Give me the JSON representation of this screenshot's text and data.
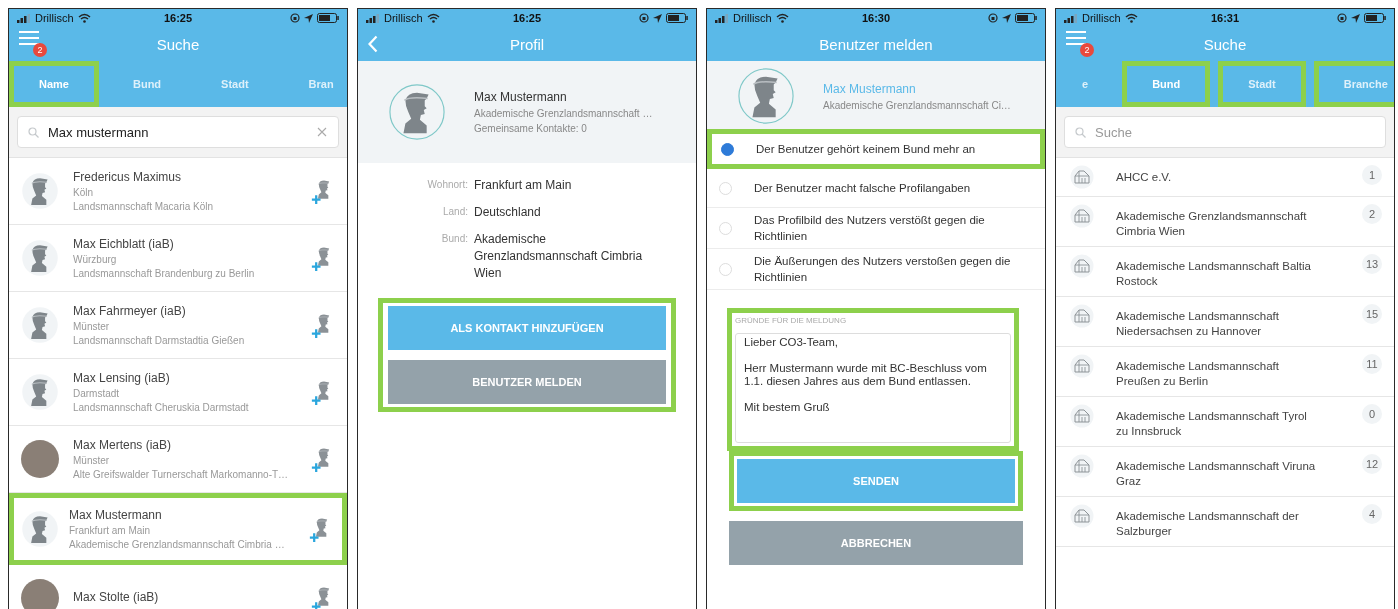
{
  "screens": [
    {
      "kind": "search_people",
      "status": {
        "carrier": "Drillisch",
        "time": "16:25"
      },
      "title": "Suche",
      "menu_badge": "2",
      "tabs": [
        {
          "label": "Name",
          "selected": true,
          "highlighted": true
        },
        {
          "label": "Bund",
          "selected": false,
          "highlighted": false
        },
        {
          "label": "Stadt",
          "selected": false,
          "highlighted": false
        },
        {
          "label": "Bran",
          "selected": false,
          "highlighted": false
        }
      ],
      "search": {
        "value": "Max mustermann"
      },
      "people": [
        {
          "name": "Fredericus Maximus",
          "city": "Köln",
          "bund": "Landsmannschaft Macaria Köln",
          "kind": "silhouette",
          "highlighted": false
        },
        {
          "name": "Max Eichblatt (iaB)",
          "city": "Würzburg",
          "bund": "Landsmannschaft Brandenburg zu Berlin",
          "kind": "silhouette",
          "highlighted": false
        },
        {
          "name": "Max Fahrmeyer (iaB)",
          "city": "Münster",
          "bund": "Landsmannschaft Darmstadtia Gießen",
          "kind": "silhouette",
          "highlighted": false
        },
        {
          "name": "Max Lensing (iaB)",
          "city": "Darmstadt",
          "bund": "Landsmannschaft Cheruskia Darmstadt",
          "kind": "silhouette",
          "highlighted": false
        },
        {
          "name": "Max Mertens (iaB)",
          "city": "Münster",
          "bund": "Alte Greifswalder Turnerschaft Markomanno-T…",
          "kind": "photo",
          "highlighted": false
        },
        {
          "name": "Max Mustermann",
          "city": "Frankfurt am Main",
          "bund": "Akademische Grenzlandsmannschaft Cimbria …",
          "kind": "silhouette",
          "highlighted": true
        },
        {
          "name": "Max Stolte (iaB)",
          "kind": "photo",
          "highlighted": false
        }
      ]
    },
    {
      "kind": "profile",
      "status": {
        "carrier": "Drillisch",
        "time": "16:25"
      },
      "title": "Profil",
      "profile": {
        "name": "Max Mustermann",
        "bund": "Akademische Grenzlandsmannschaft …",
        "contacts": "Gemeinsame Kontakte: 0"
      },
      "details": [
        {
          "label": "Wohnort:",
          "value": "Frankfurt am Main"
        },
        {
          "label": "Land:",
          "value": "Deutschland"
        },
        {
          "label": "Bund:",
          "value": "Akademische Grenzlandsmannschaft Cimbria Wien"
        }
      ],
      "actions_highlighted": true,
      "buttons": [
        {
          "label": "ALS KONTAKT HINZUFÜGEN",
          "kind": "primary"
        },
        {
          "label": "BENUTZER MELDEN",
          "kind": "secondary"
        }
      ]
    },
    {
      "kind": "report",
      "status": {
        "carrier": "Drillisch",
        "time": "16:30"
      },
      "title": "Benutzer melden",
      "profile": {
        "name": "Max Mustermann",
        "bund": "Akademische Grenzlandsmannschaft Ci…"
      },
      "reasons": [
        {
          "text": "Der Benutzer gehört keinem Bund mehr an",
          "selected": true,
          "highlighted": true
        },
        {
          "text": "Der Benutzer macht falsche Profilangaben",
          "selected": false,
          "highlighted": false
        },
        {
          "text": "Das Profilbild des Nutzers verstößt gegen die Richtlinien",
          "selected": false,
          "highlighted": false
        },
        {
          "text": "Die Äußerungen des Nutzers verstoßen gegen die Richtlinien",
          "selected": false,
          "highlighted": false
        }
      ],
      "message": {
        "label": "GRÜNDE FÜR DIE MELDUNG",
        "value": "Lieber CO3-Team,\n\nHerr Mustermann wurde mit BC-Beschluss vom 1.1. diesen Jahres aus dem Bund entlassen.\n\nMit bestem Gruß",
        "highlighted": true
      },
      "buttons": [
        {
          "label": "SENDEN",
          "kind": "primary",
          "highlighted": true
        },
        {
          "label": "ABBRECHEN",
          "kind": "secondary",
          "highlighted": false
        }
      ]
    },
    {
      "kind": "search_bund",
      "status": {
        "carrier": "Drillisch",
        "time": "16:31"
      },
      "title": "Suche",
      "menu_badge": "2",
      "tabs": [
        {
          "label": "e",
          "selected": false,
          "highlighted": false
        },
        {
          "label": "Bund",
          "selected": true,
          "highlighted": true
        },
        {
          "label": "Stadt",
          "selected": false,
          "highlighted": true
        },
        {
          "label": "Branche",
          "selected": false,
          "highlighted": true
        }
      ],
      "search": {
        "placeholder": "Suche"
      },
      "bunds": [
        {
          "name": "AHCC e.V.",
          "count": "1"
        },
        {
          "name": "Akademische Grenzlandsmannschaft Cimbria Wien",
          "count": "2"
        },
        {
          "name": "Akademische Landsmannschaft Baltia Rostock",
          "count": "13"
        },
        {
          "name": "Akademische Landsmannschaft Niedersachsen zu Hannover",
          "count": "15"
        },
        {
          "name": "Akademische Landsmannschaft Preußen zu Berlin",
          "count": "11"
        },
        {
          "name": "Akademische Landsmannschaft Tyrol zu Innsbruck",
          "count": "0"
        },
        {
          "name": "Akademische Landsmannschaft Viruna Graz",
          "count": "12"
        },
        {
          "name": "Akademische Landsmannschaft der Salzburger",
          "count": "4"
        }
      ]
    }
  ]
}
